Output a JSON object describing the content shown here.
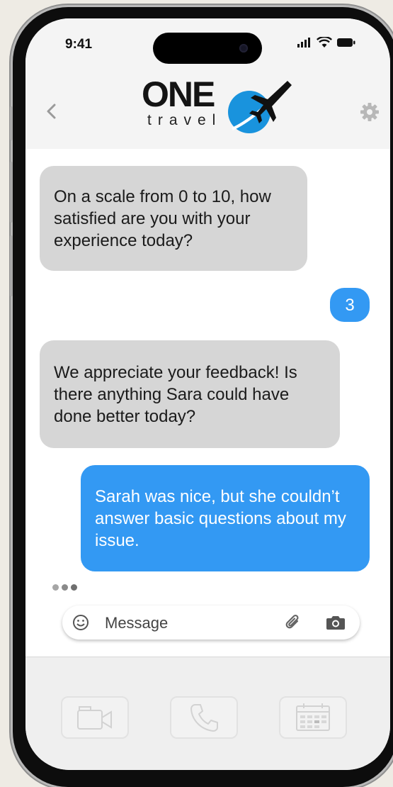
{
  "status_bar": {
    "time": "9:41"
  },
  "header": {
    "logo_primary": "ONE",
    "logo_secondary": "travel",
    "back_icon": "chevron-left-icon",
    "settings_icon": "gear-icon"
  },
  "messages": [
    {
      "sender": "agent",
      "text": "On a scale from 0 to 10, how satisfied are you with your experience today?"
    },
    {
      "sender": "user",
      "text": "3"
    },
    {
      "sender": "agent",
      "text": "We appreciate your feedback! Is there anything Sara could have done better today?"
    },
    {
      "sender": "user",
      "text": "Sarah was nice, but she couldn’t answer basic questions about my issue."
    }
  ],
  "composer": {
    "placeholder": "Message",
    "icons": [
      "smiley-icon",
      "paperclip-icon",
      "camera-icon"
    ]
  },
  "actions": [
    "video-call-icon",
    "phone-icon",
    "calendar-icon"
  ],
  "colors": {
    "accent": "#3399f3",
    "incoming_bubble": "#d6d6d6",
    "logo_globe": "#1993dd"
  }
}
